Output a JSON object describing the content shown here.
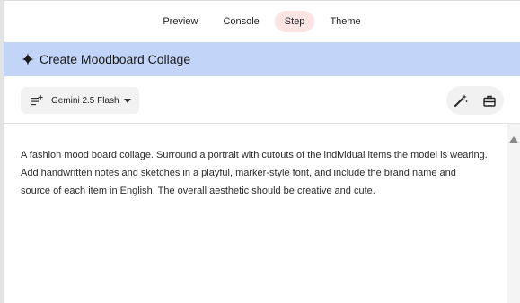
{
  "tabs": [
    {
      "label": "Preview",
      "active": false
    },
    {
      "label": "Console",
      "active": false
    },
    {
      "label": "Step",
      "active": true
    },
    {
      "label": "Theme",
      "active": false
    }
  ],
  "header": {
    "icon": "sparkle-icon",
    "title": "Create Moodboard Collage"
  },
  "toolbar": {
    "model": {
      "icon": "model-list-icon",
      "label": "Gemini 2.5 Flash",
      "caret_icon": "caret-down-icon"
    },
    "actions": [
      {
        "icon": "magic-wand-icon"
      },
      {
        "icon": "toolbox-icon"
      }
    ]
  },
  "prompt": {
    "text": "A fashion mood board collage. Surround a portrait with cutouts of the individual items the model is wearing. Add handwritten notes and sketches in a playful, marker-style font, and include the brand name and source of each item in English. The overall aesthetic should be creative and cute."
  },
  "colors": {
    "header_bg": "#c2d4f8",
    "active_tab_bg": "#fbe4e4"
  }
}
